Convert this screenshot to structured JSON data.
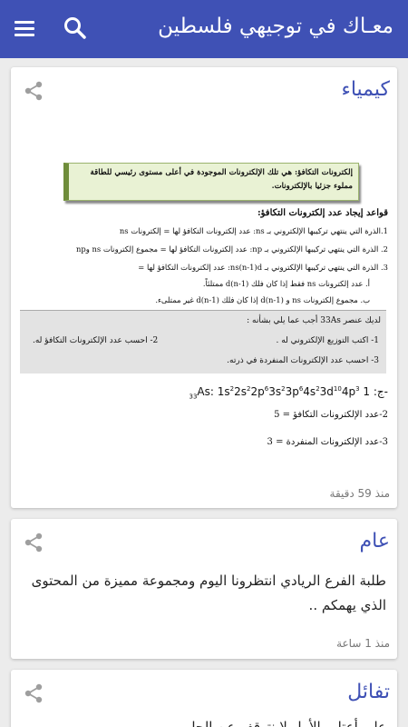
{
  "app_bar": {
    "title": "معـاك في توجيهي فلسطين",
    "menu_icon": "menu-icon",
    "search_icon": "search-icon",
    "color": "#3f51b5"
  },
  "cards": [
    {
      "category": "كيمياء",
      "time": "منذ 59 دقيقة",
      "document": {
        "definition": "إلكترونات التكافؤ: هي تلك الإلكترونات الموجودة في أعلى مستوى رئيسي للطاقة مملوء جزئيا بالإلكترونات.",
        "rules_title": "قواعد إيجاد عدد إلكترونات التكافؤ:",
        "rules": [
          "1.الذرة التي ينتهي تركيبها الإلكتروني بـ ns: عدد إلكترونات التكافؤ لها = إلكترونات ns",
          "2. الذرة التي ينتهي تركيبها الإلكتروني بـ np: عدد إلكترونات التكافؤ لها = مجموع إلكترونات ns وnp",
          "3. الذرة التي ينتهي تركيبها الإلكتروني بـ ns(n-1)d: عدد إلكترونات التكافؤ لها =",
          "أ. عدد إلكترونات ns فقط إذا كان فلك d(n-1) ممتلئاً.",
          "ب. مجموع إلكترونات ns و d(n-1) إذا كان فلك d(n-1) غير ممتلىء."
        ],
        "question_intro": "لديك عنصر 33As أجب عما يلي بشأنه :",
        "question_1": "1- اكتب التوزيع الإلكتروني له .",
        "question_2": "2- احسب عدد الإلكترونات التكافؤ له.",
        "question_3": "3- احسب عدد الإلكترونات المنفردة في ذرته.",
        "answer_prefix": "ج: 1-",
        "answer_2": "2-عدد الإلكترونات التكافؤ = 5",
        "answer_3": "3-عدد الإلكترونات المنفردة = 3"
      }
    },
    {
      "category": "عام",
      "body": "طلبة الفرع الريادي انتظرونا اليوم ومجموعة مميزة من المحتوى الذي يهمكم ..",
      "time": "منذ 1 ساعة"
    },
    {
      "category": "تفائل",
      "body": "على أعتاب الأمل لا نتوقف عن الحلم"
    }
  ],
  "share_icon": "share-icon"
}
